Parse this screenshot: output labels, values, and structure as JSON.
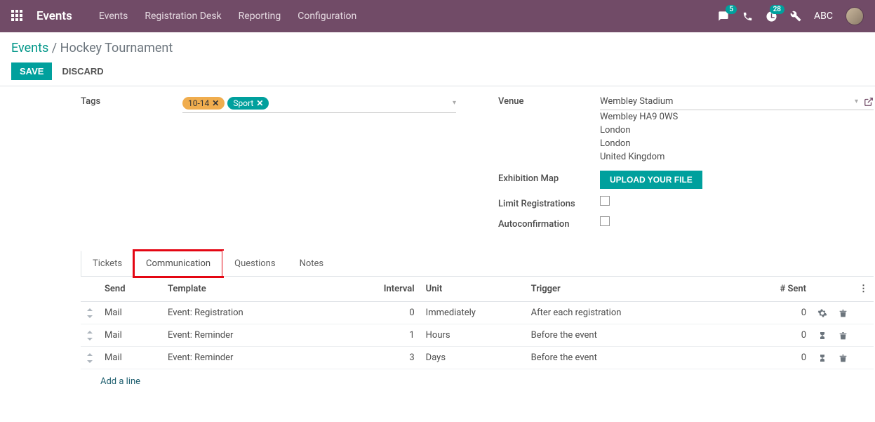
{
  "navbar": {
    "brand": "Events",
    "links": [
      "Events",
      "Registration Desk",
      "Reporting",
      "Configuration"
    ],
    "messages_badge": "5",
    "activities_badge": "28",
    "user": "ABC"
  },
  "breadcrumb": {
    "root": "Events",
    "sep": " / ",
    "current": "Hockey Tournament"
  },
  "actions": {
    "save": "SAVE",
    "discard": "DISCARD"
  },
  "form": {
    "tags_label": "Tags",
    "tags": [
      {
        "text": "10-14",
        "color": "orange"
      },
      {
        "text": "Sport",
        "color": "teal"
      }
    ],
    "venue_label": "Venue",
    "venue_name": "Wembley Stadium",
    "venue_address": [
      "Wembley HA9 0WS",
      "London",
      "London",
      "United Kingdom"
    ],
    "exhibition_map_label": "Exhibition Map",
    "upload_button": "UPLOAD YOUR FILE",
    "limit_reg_label": "Limit Registrations",
    "autoconfirm_label": "Autoconfirmation"
  },
  "tabs": [
    "Tickets",
    "Communication",
    "Questions",
    "Notes"
  ],
  "comm_table": {
    "headers": {
      "send": "Send",
      "template": "Template",
      "interval": "Interval",
      "unit": "Unit",
      "trigger": "Trigger",
      "sent": "# Sent"
    },
    "rows": [
      {
        "send": "Mail",
        "template": "Event: Registration",
        "interval": "0",
        "unit": "Immediately",
        "trigger": "After each registration",
        "sent": "0",
        "icon": "cogs"
      },
      {
        "send": "Mail",
        "template": "Event: Reminder",
        "interval": "1",
        "unit": "Hours",
        "trigger": "Before the event",
        "sent": "0",
        "icon": "hourglass"
      },
      {
        "send": "Mail",
        "template": "Event: Reminder",
        "interval": "3",
        "unit": "Days",
        "trigger": "Before the event",
        "sent": "0",
        "icon": "hourglass"
      }
    ],
    "add_line": "Add a line"
  }
}
